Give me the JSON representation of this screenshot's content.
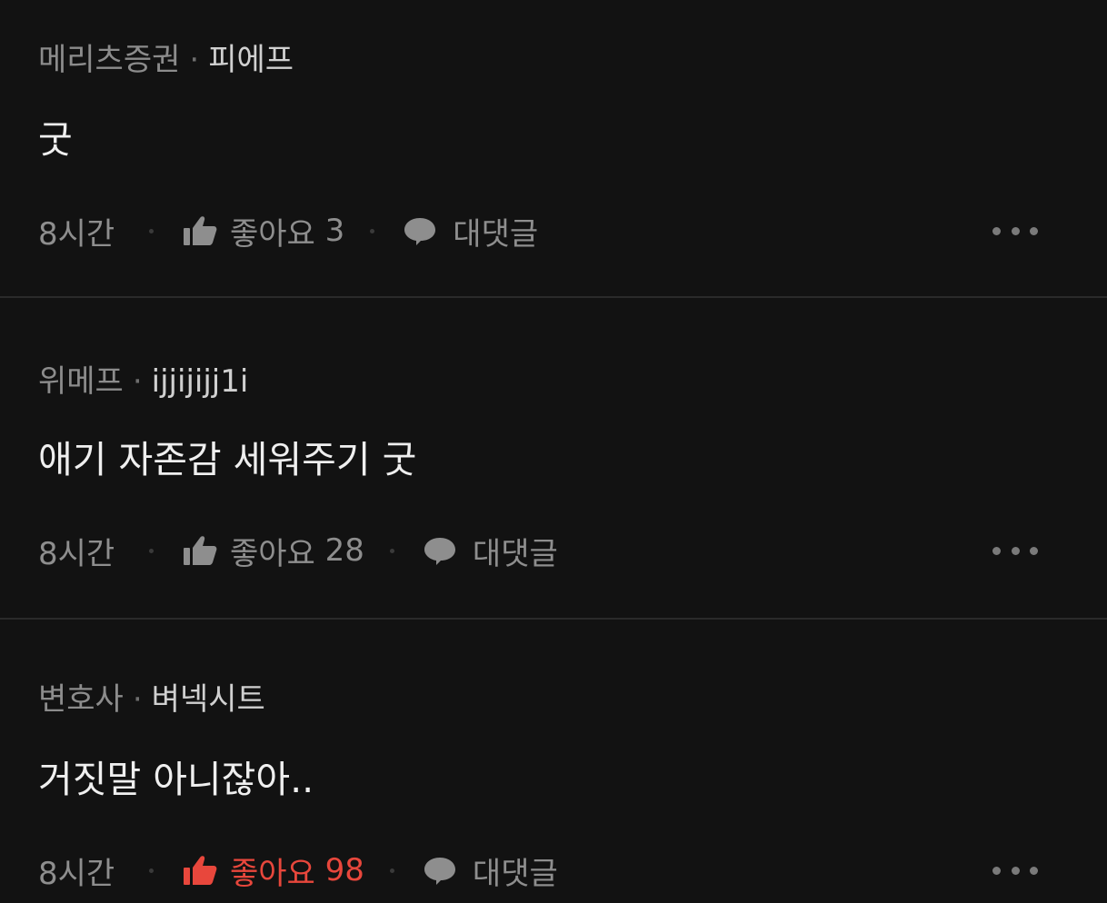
{
  "colors": {
    "background": "#121212",
    "divider": "#2a2a2a",
    "muted": "#8e8e8e",
    "like_active": "#e8473c"
  },
  "comments": [
    {
      "company": "메리츠증권",
      "separator": "·",
      "nickname": "피에프",
      "text": "굿",
      "time": "8시간",
      "like_label": "좋아요",
      "like_count": "3",
      "reply_label": "대댓글",
      "liked": false
    },
    {
      "company": "위메프",
      "separator": "·",
      "nickname": "ijjijijj1i",
      "text": "애기 자존감 세워주기 굿",
      "time": "8시간",
      "like_label": "좋아요",
      "like_count": "28",
      "reply_label": "대댓글",
      "liked": false
    },
    {
      "company": "변호사",
      "separator": "·",
      "nickname": "벼넥시트",
      "text": "거짓말 아니잖아..",
      "time": "8시간",
      "like_label": "좋아요",
      "like_count": "98",
      "reply_label": "대댓글",
      "liked": true
    }
  ],
  "icons": {
    "like": "thumbs-up-icon",
    "reply": "speech-bubble-icon",
    "more": "more-dots-icon"
  }
}
